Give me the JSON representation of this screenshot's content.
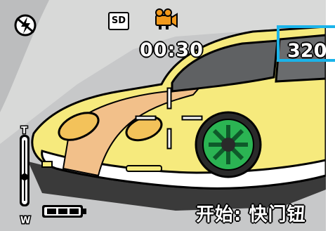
{
  "osd": {
    "flash_icon": "flash-off-icon",
    "storage_label": "SD",
    "mode_icon": "movie-mode-icon",
    "remaining_time": "00:30",
    "resolution": "320",
    "zoom_top_label": "T",
    "zoom_bottom_label": "W",
    "battery_icon": "battery-full-icon",
    "hint": "开始: 快门钮"
  },
  "colors": {
    "marker": "#1bb4ea",
    "car_body": "#f6ea7d",
    "stripe": "#f2c08a",
    "wheel_green": "#2bb453"
  }
}
